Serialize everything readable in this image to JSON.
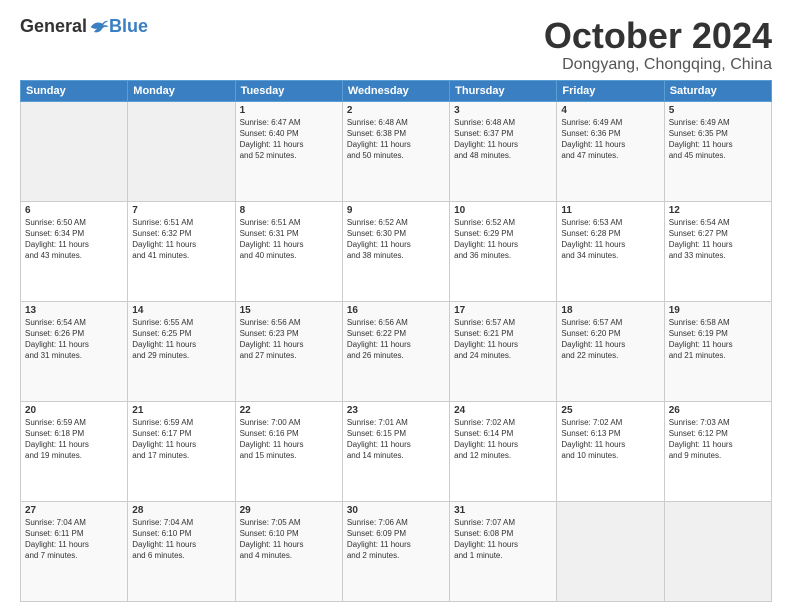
{
  "header": {
    "logo_general": "General",
    "logo_blue": "Blue",
    "month_title": "October 2024",
    "location": "Dongyang, Chongqing, China"
  },
  "weekdays": [
    "Sunday",
    "Monday",
    "Tuesday",
    "Wednesday",
    "Thursday",
    "Friday",
    "Saturday"
  ],
  "weeks": [
    [
      {
        "day": "",
        "info": ""
      },
      {
        "day": "",
        "info": ""
      },
      {
        "day": "1",
        "info": "Sunrise: 6:47 AM\nSunset: 6:40 PM\nDaylight: 11 hours\nand 52 minutes."
      },
      {
        "day": "2",
        "info": "Sunrise: 6:48 AM\nSunset: 6:38 PM\nDaylight: 11 hours\nand 50 minutes."
      },
      {
        "day": "3",
        "info": "Sunrise: 6:48 AM\nSunset: 6:37 PM\nDaylight: 11 hours\nand 48 minutes."
      },
      {
        "day": "4",
        "info": "Sunrise: 6:49 AM\nSunset: 6:36 PM\nDaylight: 11 hours\nand 47 minutes."
      },
      {
        "day": "5",
        "info": "Sunrise: 6:49 AM\nSunset: 6:35 PM\nDaylight: 11 hours\nand 45 minutes."
      }
    ],
    [
      {
        "day": "6",
        "info": "Sunrise: 6:50 AM\nSunset: 6:34 PM\nDaylight: 11 hours\nand 43 minutes."
      },
      {
        "day": "7",
        "info": "Sunrise: 6:51 AM\nSunset: 6:32 PM\nDaylight: 11 hours\nand 41 minutes."
      },
      {
        "day": "8",
        "info": "Sunrise: 6:51 AM\nSunset: 6:31 PM\nDaylight: 11 hours\nand 40 minutes."
      },
      {
        "day": "9",
        "info": "Sunrise: 6:52 AM\nSunset: 6:30 PM\nDaylight: 11 hours\nand 38 minutes."
      },
      {
        "day": "10",
        "info": "Sunrise: 6:52 AM\nSunset: 6:29 PM\nDaylight: 11 hours\nand 36 minutes."
      },
      {
        "day": "11",
        "info": "Sunrise: 6:53 AM\nSunset: 6:28 PM\nDaylight: 11 hours\nand 34 minutes."
      },
      {
        "day": "12",
        "info": "Sunrise: 6:54 AM\nSunset: 6:27 PM\nDaylight: 11 hours\nand 33 minutes."
      }
    ],
    [
      {
        "day": "13",
        "info": "Sunrise: 6:54 AM\nSunset: 6:26 PM\nDaylight: 11 hours\nand 31 minutes."
      },
      {
        "day": "14",
        "info": "Sunrise: 6:55 AM\nSunset: 6:25 PM\nDaylight: 11 hours\nand 29 minutes."
      },
      {
        "day": "15",
        "info": "Sunrise: 6:56 AM\nSunset: 6:23 PM\nDaylight: 11 hours\nand 27 minutes."
      },
      {
        "day": "16",
        "info": "Sunrise: 6:56 AM\nSunset: 6:22 PM\nDaylight: 11 hours\nand 26 minutes."
      },
      {
        "day": "17",
        "info": "Sunrise: 6:57 AM\nSunset: 6:21 PM\nDaylight: 11 hours\nand 24 minutes."
      },
      {
        "day": "18",
        "info": "Sunrise: 6:57 AM\nSunset: 6:20 PM\nDaylight: 11 hours\nand 22 minutes."
      },
      {
        "day": "19",
        "info": "Sunrise: 6:58 AM\nSunset: 6:19 PM\nDaylight: 11 hours\nand 21 minutes."
      }
    ],
    [
      {
        "day": "20",
        "info": "Sunrise: 6:59 AM\nSunset: 6:18 PM\nDaylight: 11 hours\nand 19 minutes."
      },
      {
        "day": "21",
        "info": "Sunrise: 6:59 AM\nSunset: 6:17 PM\nDaylight: 11 hours\nand 17 minutes."
      },
      {
        "day": "22",
        "info": "Sunrise: 7:00 AM\nSunset: 6:16 PM\nDaylight: 11 hours\nand 15 minutes."
      },
      {
        "day": "23",
        "info": "Sunrise: 7:01 AM\nSunset: 6:15 PM\nDaylight: 11 hours\nand 14 minutes."
      },
      {
        "day": "24",
        "info": "Sunrise: 7:02 AM\nSunset: 6:14 PM\nDaylight: 11 hours\nand 12 minutes."
      },
      {
        "day": "25",
        "info": "Sunrise: 7:02 AM\nSunset: 6:13 PM\nDaylight: 11 hours\nand 10 minutes."
      },
      {
        "day": "26",
        "info": "Sunrise: 7:03 AM\nSunset: 6:12 PM\nDaylight: 11 hours\nand 9 minutes."
      }
    ],
    [
      {
        "day": "27",
        "info": "Sunrise: 7:04 AM\nSunset: 6:11 PM\nDaylight: 11 hours\nand 7 minutes."
      },
      {
        "day": "28",
        "info": "Sunrise: 7:04 AM\nSunset: 6:10 PM\nDaylight: 11 hours\nand 6 minutes."
      },
      {
        "day": "29",
        "info": "Sunrise: 7:05 AM\nSunset: 6:10 PM\nDaylight: 11 hours\nand 4 minutes."
      },
      {
        "day": "30",
        "info": "Sunrise: 7:06 AM\nSunset: 6:09 PM\nDaylight: 11 hours\nand 2 minutes."
      },
      {
        "day": "31",
        "info": "Sunrise: 7:07 AM\nSunset: 6:08 PM\nDaylight: 11 hours\nand 1 minute."
      },
      {
        "day": "",
        "info": ""
      },
      {
        "day": "",
        "info": ""
      }
    ]
  ]
}
